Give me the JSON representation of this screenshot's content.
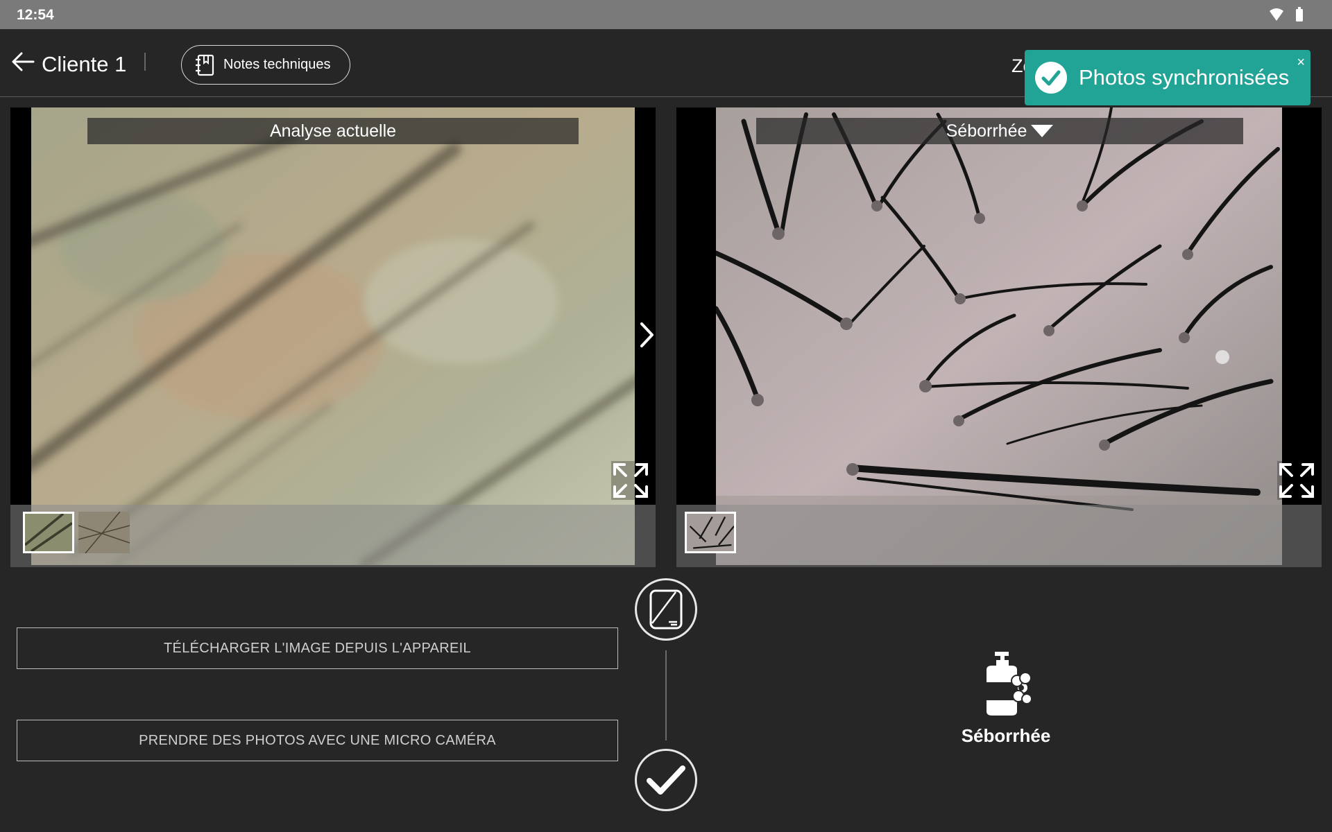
{
  "status_bar": {
    "time": "12:54"
  },
  "header": {
    "client_name": "Cliente 1",
    "notes_button_label": "Notes techniques",
    "zoom_label": "Zo"
  },
  "toast": {
    "message": "Photos synchronisées",
    "close_label": "×"
  },
  "left_panel": {
    "title": "Analyse actuelle"
  },
  "right_panel": {
    "title": "Séborrhée"
  },
  "actions": {
    "download_label": "TÉLÉCHARGER L'IMAGE DEPUIS L'APPAREIL",
    "camera_label": "PRENDRE DES PHOTOS AVEC UNE MICRO CAMÉRA"
  },
  "product": {
    "name": "Séborrhée"
  },
  "colors": {
    "toast": "#21a396",
    "background": "#262626",
    "status_bar": "#7a7a7a"
  }
}
